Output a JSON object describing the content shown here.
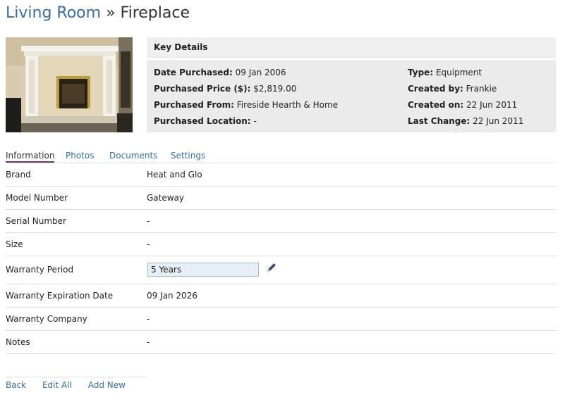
{
  "breadcrumb": {
    "parent": "Living Room",
    "separator": "»",
    "current": "Fireplace"
  },
  "photo": {
    "icon": "fireplace-photo"
  },
  "key_details": {
    "title": "Key Details",
    "left": [
      {
        "label": "Date Purchased:",
        "value": "09 Jan 2006"
      },
      {
        "label": "Purchased Price ($):",
        "value": "$2,819.00"
      },
      {
        "label": "Purchased From:",
        "value": "Fireside Hearth & Home"
      },
      {
        "label": "Purchased Location:",
        "value": "-"
      }
    ],
    "right": [
      {
        "label": "Type:",
        "value": "Equipment"
      },
      {
        "label": "Created by:",
        "value": "Frankie"
      },
      {
        "label": "Created on:",
        "value": "22 Jun 2011"
      },
      {
        "label": "Last Change:",
        "value": "22 Jun 2011"
      }
    ]
  },
  "tabs": [
    {
      "label": "Information",
      "active": true
    },
    {
      "label": "Photos",
      "active": false
    },
    {
      "label": "Documents",
      "active": false
    },
    {
      "label": "Settings",
      "active": false
    }
  ],
  "details": [
    {
      "label": "Brand",
      "value": "Heat and Glo"
    },
    {
      "label": "Model Number",
      "value": "Gateway"
    },
    {
      "label": "Serial Number",
      "value": "-"
    },
    {
      "label": "Size",
      "value": "-"
    },
    {
      "label": "Warranty Period",
      "value": "5 Years",
      "editable": true,
      "icon": "pencil-icon"
    },
    {
      "label": "Warranty Expiration Date",
      "value": "09 Jan 2026"
    },
    {
      "label": "Warranty Company",
      "value": "-"
    },
    {
      "label": "Notes",
      "value": "-"
    }
  ],
  "footer": {
    "back": "Back",
    "edit_all": "Edit All",
    "add_new": "Add New"
  },
  "colors": {
    "link": "#3b6e9c",
    "active_tab_underline": "#6d3a68",
    "panel_bg": "#ebebeb",
    "input_bg": "#e6eef7"
  }
}
